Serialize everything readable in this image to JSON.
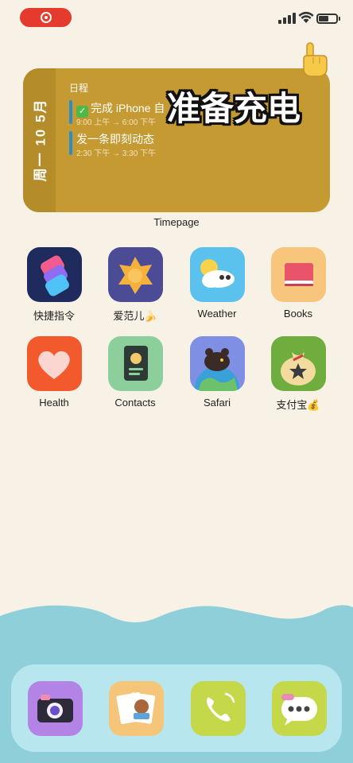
{
  "status_bar": {
    "battery_level": 0.55,
    "icons": [
      "record-icon",
      "cellular-signal-icon",
      "wifi-icon",
      "battery-icon"
    ]
  },
  "overlay": {
    "caption": "准备充电"
  },
  "widget": {
    "date_label": "周一 10 5月",
    "header": "日程",
    "events": [
      {
        "title": "完成 iPhone 自",
        "time": "9:00 上午 → 6:00 下午"
      },
      {
        "title": "发一条即刻动态",
        "time": "2:30 下午 → 3:30 下午"
      }
    ],
    "app_name": "Timepage"
  },
  "apps": [
    {
      "label": "快捷指令",
      "icon": "shortcuts-icon"
    },
    {
      "label": "爱范儿🍌",
      "icon": "ifanr-icon"
    },
    {
      "label": "Weather",
      "icon": "weather-icon"
    },
    {
      "label": "Books",
      "icon": "books-icon"
    },
    {
      "label": "Health",
      "icon": "health-icon"
    },
    {
      "label": "Contacts",
      "icon": "contacts-icon"
    },
    {
      "label": "Safari",
      "icon": "safari-icon"
    },
    {
      "label": "支付宝💰",
      "icon": "alipay-icon"
    }
  ],
  "dock": {
    "apps": [
      "camera-icon",
      "photos-icon",
      "phone-icon",
      "messages-icon"
    ]
  }
}
